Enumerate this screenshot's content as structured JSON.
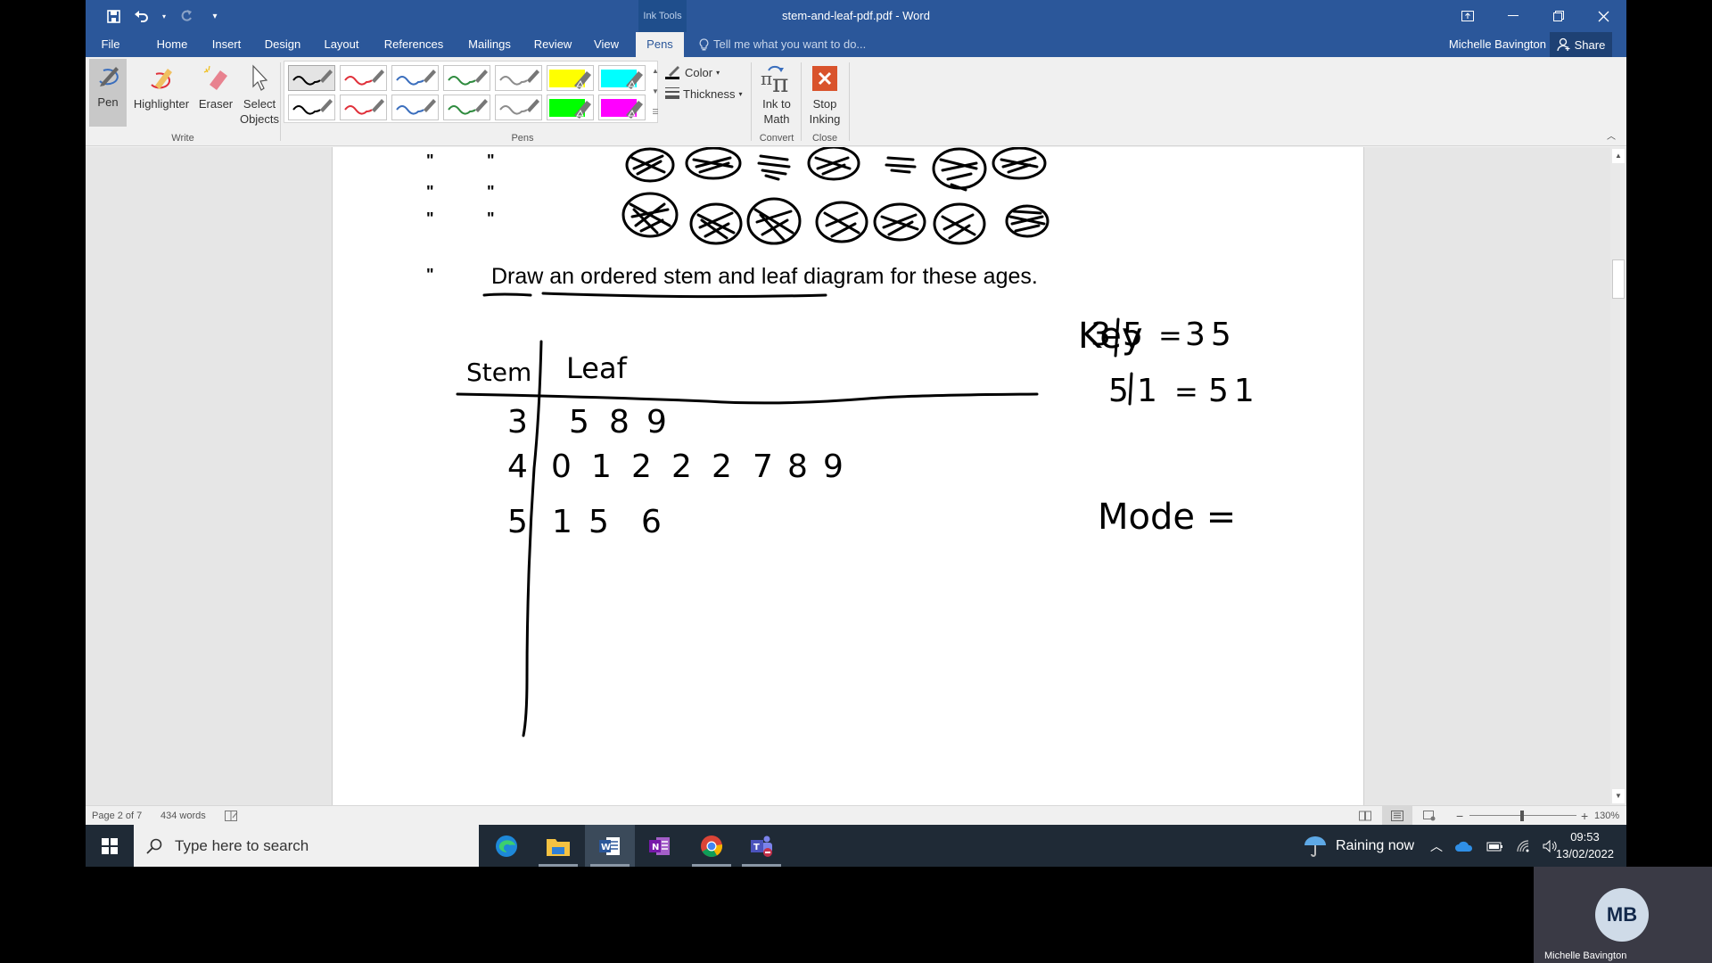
{
  "window": {
    "title": "stem-and-leaf-pdf.pdf - Word",
    "context_tab_group": "Ink Tools",
    "controls": [
      "ribbon-display-options",
      "minimize",
      "restore",
      "close"
    ]
  },
  "qat": {
    "save": "save-icon",
    "undo": "undo-icon",
    "redo": "redo-icon",
    "customize": "customize-qat-icon"
  },
  "tabs": [
    {
      "label": "File"
    },
    {
      "label": "Home"
    },
    {
      "label": "Insert"
    },
    {
      "label": "Design"
    },
    {
      "label": "Layout"
    },
    {
      "label": "References"
    },
    {
      "label": "Mailings"
    },
    {
      "label": "Review"
    },
    {
      "label": "View"
    },
    {
      "label": "Pens",
      "active": true
    }
  ],
  "tell_me": "Tell me what you want to do...",
  "user": {
    "name": "Michelle Bavington",
    "initials": "MB"
  },
  "share_label": "Share",
  "ribbon": {
    "write_group": {
      "label": "Write",
      "buttons": [
        {
          "label": "Pen",
          "selected": true
        },
        {
          "label": "Highlighter"
        },
        {
          "label": "Eraser"
        },
        {
          "label": "Select Objects"
        }
      ]
    },
    "pens_group": {
      "label": "Pens",
      "row1": [
        {
          "type": "pen",
          "color": "#000000",
          "selected": true
        },
        {
          "type": "pen",
          "color": "#e0303a"
        },
        {
          "type": "pen",
          "color": "#3a6ebd"
        },
        {
          "type": "pen",
          "color": "#2e8b3e"
        },
        {
          "type": "pen",
          "color": "#8c8c8c"
        },
        {
          "type": "highlighter",
          "color": "#ffff00"
        },
        {
          "type": "highlighter",
          "color": "#00ffff"
        }
      ],
      "row2": [
        {
          "type": "pen",
          "color": "#000000"
        },
        {
          "type": "pen",
          "color": "#e0303a"
        },
        {
          "type": "pen",
          "color": "#3a6ebd"
        },
        {
          "type": "pen",
          "color": "#2e8b3e"
        },
        {
          "type": "pen",
          "color": "#8c8c8c"
        },
        {
          "type": "highlighter",
          "color": "#00ff00"
        },
        {
          "type": "highlighter",
          "color": "#ff00ff"
        }
      ],
      "color_label": "Color",
      "thickness_label": "Thickness"
    },
    "convert_group": {
      "label": "Convert",
      "button": "Ink to Math"
    },
    "close_group": {
      "label": "Close",
      "button": "Stop Inking"
    }
  },
  "document": {
    "ditto_mark": "\"",
    "instruction": "Draw an ordered stem and leaf diagram for these ages.",
    "stem_leaf": {
      "stem_header": "Stem",
      "leaf_header": "Leaf",
      "rows": [
        {
          "stem": "3",
          "leaves": [
            "5",
            "8",
            "9"
          ]
        },
        {
          "stem": "4",
          "leaves": [
            "0",
            "1",
            "2",
            "2",
            "2",
            "7",
            "8",
            "9"
          ]
        },
        {
          "stem": "5",
          "leaves": [
            "1",
            "5",
            "6"
          ]
        }
      ]
    },
    "key": {
      "label": "Key",
      "lines": [
        {
          "stem": "3",
          "leaf": "5",
          "value": "35"
        },
        {
          "stem": "5",
          "leaf": "1",
          "value": "51"
        }
      ]
    },
    "mode_label": "Mode ="
  },
  "status": {
    "page": "Page 2 of 7",
    "words": "434 words",
    "zoom": "130%",
    "zoom_minus": "−",
    "zoom_plus": "+"
  },
  "taskbar": {
    "search_placeholder": "Type here to search",
    "apps": [
      "Microsoft Edge",
      "File Explorer",
      "Word",
      "OneNote",
      "Google Chrome",
      "Microsoft Teams"
    ],
    "weather": "Raining now",
    "time": "09:53",
    "date": "13/02/2022"
  }
}
